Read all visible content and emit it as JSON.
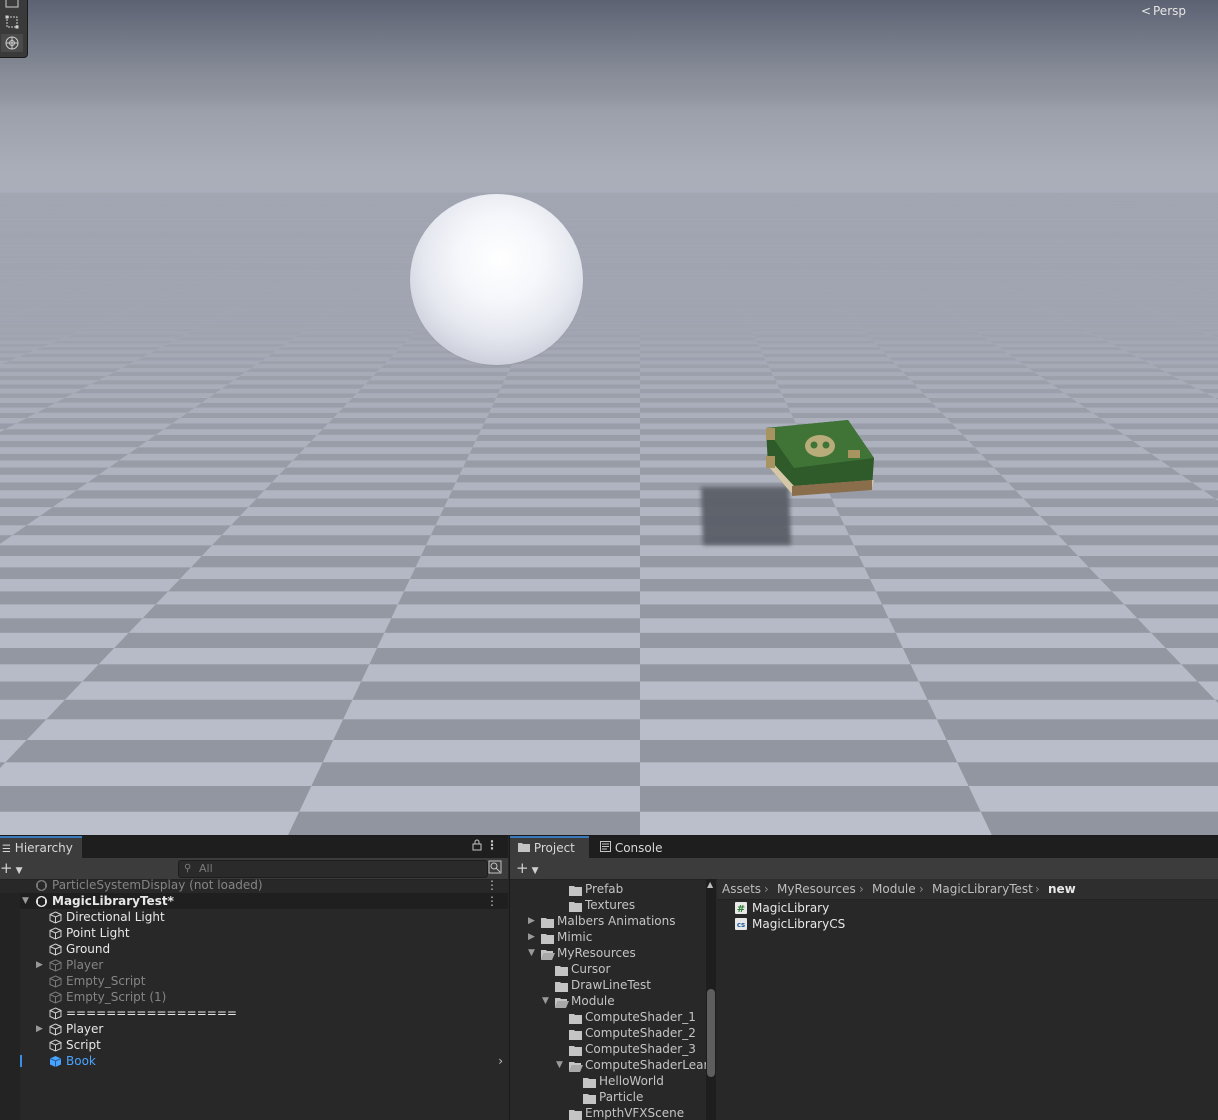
{
  "scene": {
    "camera_label": "Persp",
    "tools": [
      "rect-tool-icon",
      "transform-tool-icon",
      "custom-tool-icon"
    ]
  },
  "hierarchy": {
    "tab_label": "Hierarchy",
    "search_placeholder": "All",
    "items": [
      {
        "label": "ParticleSystemDisplay (not loaded)",
        "state": "unloaded-scene"
      },
      {
        "label": "MagicLibraryTest*",
        "state": "scene"
      },
      {
        "label": "Directional Light",
        "state": "normal"
      },
      {
        "label": "Point Light",
        "state": "normal"
      },
      {
        "label": "Ground",
        "state": "normal"
      },
      {
        "label": "Player",
        "state": "disabled"
      },
      {
        "label": "Empty_Script",
        "state": "disabled"
      },
      {
        "label": "Empty_Script (1)",
        "state": "disabled"
      },
      {
        "label": "=================",
        "state": "normal"
      },
      {
        "label": "Player",
        "state": "normal"
      },
      {
        "label": "Script",
        "state": "normal"
      },
      {
        "label": "Book",
        "state": "selected"
      }
    ]
  },
  "project": {
    "tabs": [
      "Project",
      "Console"
    ],
    "tree": [
      {
        "label": "Prefab"
      },
      {
        "label": "Textures"
      },
      {
        "label": "Malbers Animations"
      },
      {
        "label": "Mimic"
      },
      {
        "label": "MyResources"
      },
      {
        "label": "Cursor"
      },
      {
        "label": "DrawLineTest"
      },
      {
        "label": "Module"
      },
      {
        "label": "ComputeShader_1"
      },
      {
        "label": "ComputeShader_2"
      },
      {
        "label": "ComputeShader_3"
      },
      {
        "label": "ComputeShaderLear"
      },
      {
        "label": "HelloWorld"
      },
      {
        "label": "Particle"
      },
      {
        "label": "EmpthVFXScene"
      }
    ],
    "breadcrumb": [
      "Assets",
      "MyResources",
      "Module",
      "MagicLibraryTest",
      "new"
    ],
    "files": [
      {
        "label": "MagicLibrary",
        "icon": "csharp-script-icon"
      },
      {
        "label": "MagicLibraryCS",
        "icon": "compute-shader-icon"
      }
    ]
  }
}
